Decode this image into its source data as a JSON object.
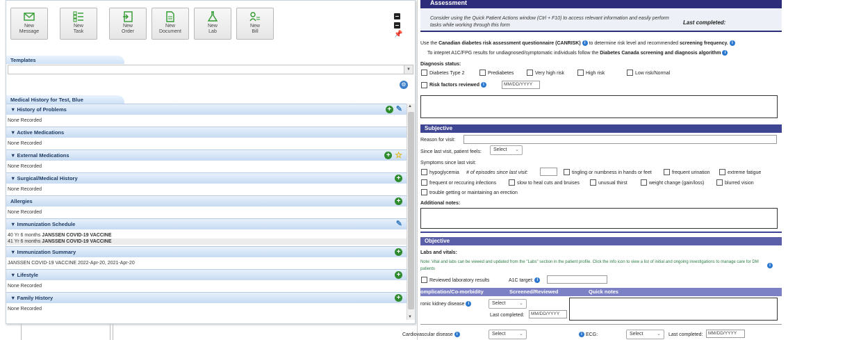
{
  "toolbar": {
    "buttons": [
      {
        "label": "New\nMessage",
        "icon": "envelope-icon"
      },
      {
        "label": "New\nTask",
        "icon": "checklist-icon"
      },
      {
        "label": "New\nOrder",
        "icon": "order-icon"
      },
      {
        "label": "New\nDocument",
        "icon": "document-icon"
      },
      {
        "label": "New\nLab",
        "icon": "flask-icon"
      },
      {
        "label": "New\nBill",
        "icon": "bill-icon"
      }
    ]
  },
  "templates": {
    "tab_label": "Templates",
    "selected": ""
  },
  "medical_history": {
    "tab_label": "Medical History for Test, Blue",
    "sections": [
      {
        "title": "History of Problems",
        "values": [
          "None Recorded"
        ]
      },
      {
        "title": "Active Medications",
        "values": [
          "None Recorded"
        ]
      },
      {
        "title": "External Medications",
        "values": [
          "None Recorded"
        ]
      },
      {
        "title": "Surgical/Medical History",
        "values": [
          "None Recorded"
        ]
      },
      {
        "title": "Allergies",
        "values": [
          "None Recorded"
        ]
      },
      {
        "title": "Immunization Schedule",
        "values": [
          {
            "prefix": "40 Yr 6 months ",
            "bold": "JANSSEN COVID-19 VACCINE"
          },
          {
            "prefix": "41 Yr 6 months ",
            "bold": "JANSSEN COVID-19 VACCINE"
          }
        ]
      },
      {
        "title": "Immunization Summary",
        "values": [
          "JANSSEN COVID-19 VACCINE 2022-Apr-20, 2021-Apr-20"
        ]
      },
      {
        "title": "Lifestyle",
        "values": [
          "None Recorded"
        ]
      },
      {
        "title": "Family History",
        "values": [
          "None Recorded"
        ]
      }
    ]
  },
  "form": {
    "assessment": {
      "title": "Assessment",
      "note": "Consider using the Quick Patient Actions window (Ctrl + F10) to access relevant information and easily perform tasks while working through this form",
      "last_completed": "Last completed:",
      "canrisk_prefix": "Use the ",
      "canrisk_bold": "Canadian diabetes risk assessment questionnaire (CANRISK)",
      "canrisk_suffix": " to determine risk level and recommended ",
      "canrisk_bold2": "screening frequency.",
      "interpret_prefix": "To intepret A1C/FPG results for undiagnosed/symptomatic individuals follow the ",
      "interpret_bold": "Diabetes Canada screening and diagnosis algorithm",
      "diagnosis_label": "Diagnosis status:",
      "diagnosis_options": [
        "Diabetes Type 2",
        "Prediabetes",
        "Very high risk",
        "High risk",
        "Low risk/Normal"
      ],
      "risk_factors_label": "Risk factors reviewed",
      "date_placeholder": "MM/DD/YYYY"
    },
    "subjective": {
      "title": "Subjective",
      "reason_label": "Reason for visit:",
      "since_label": "Since last visit, patient feels:",
      "since_value": "Select",
      "symptoms_label": "Symptoms since last visit:",
      "sym_hypo": "hypoglycemia",
      "sym_episodes": "# of episodes since last visit:",
      "sym_tingling": "tingling or numbness in hands or feet",
      "sym_urination": "frequent urination",
      "sym_fatigue": "extreme fatigue",
      "sym_infections": "frequent or reccuring infections",
      "sym_heal": "slow to heal cuts and bruises",
      "sym_thirst": "unusual thirst",
      "sym_weight": "weight change (gain/loss)",
      "sym_vision": "blurred vision",
      "sym_erection": "trouble getting or maintaining an erection",
      "notes_label": "Additional notes:"
    },
    "objective": {
      "title": "Objective",
      "labs_label": "Labs and vitals:",
      "note": "Note: Vital and labs can be viewed and updated from the \"Labs\" section in the patient profile. Click the info icon to view a list of initial and ongoing investigations to manage care for DM patients",
      "reviewed_label": "Reviewed laboratory results",
      "a1c_label": "A1C target:",
      "table_headers": [
        "omplication/Co-morbidity",
        "Screened/Reviewed",
        "Quick notes"
      ],
      "ckd_label": "ronic kidney disease",
      "select_label": "Select",
      "last_completed_label": "Last completed:",
      "date_placeholder": "MM/DD/YYYY",
      "cvd_label": "Cardiovascular disease",
      "ecg_label": "ECG:"
    }
  }
}
